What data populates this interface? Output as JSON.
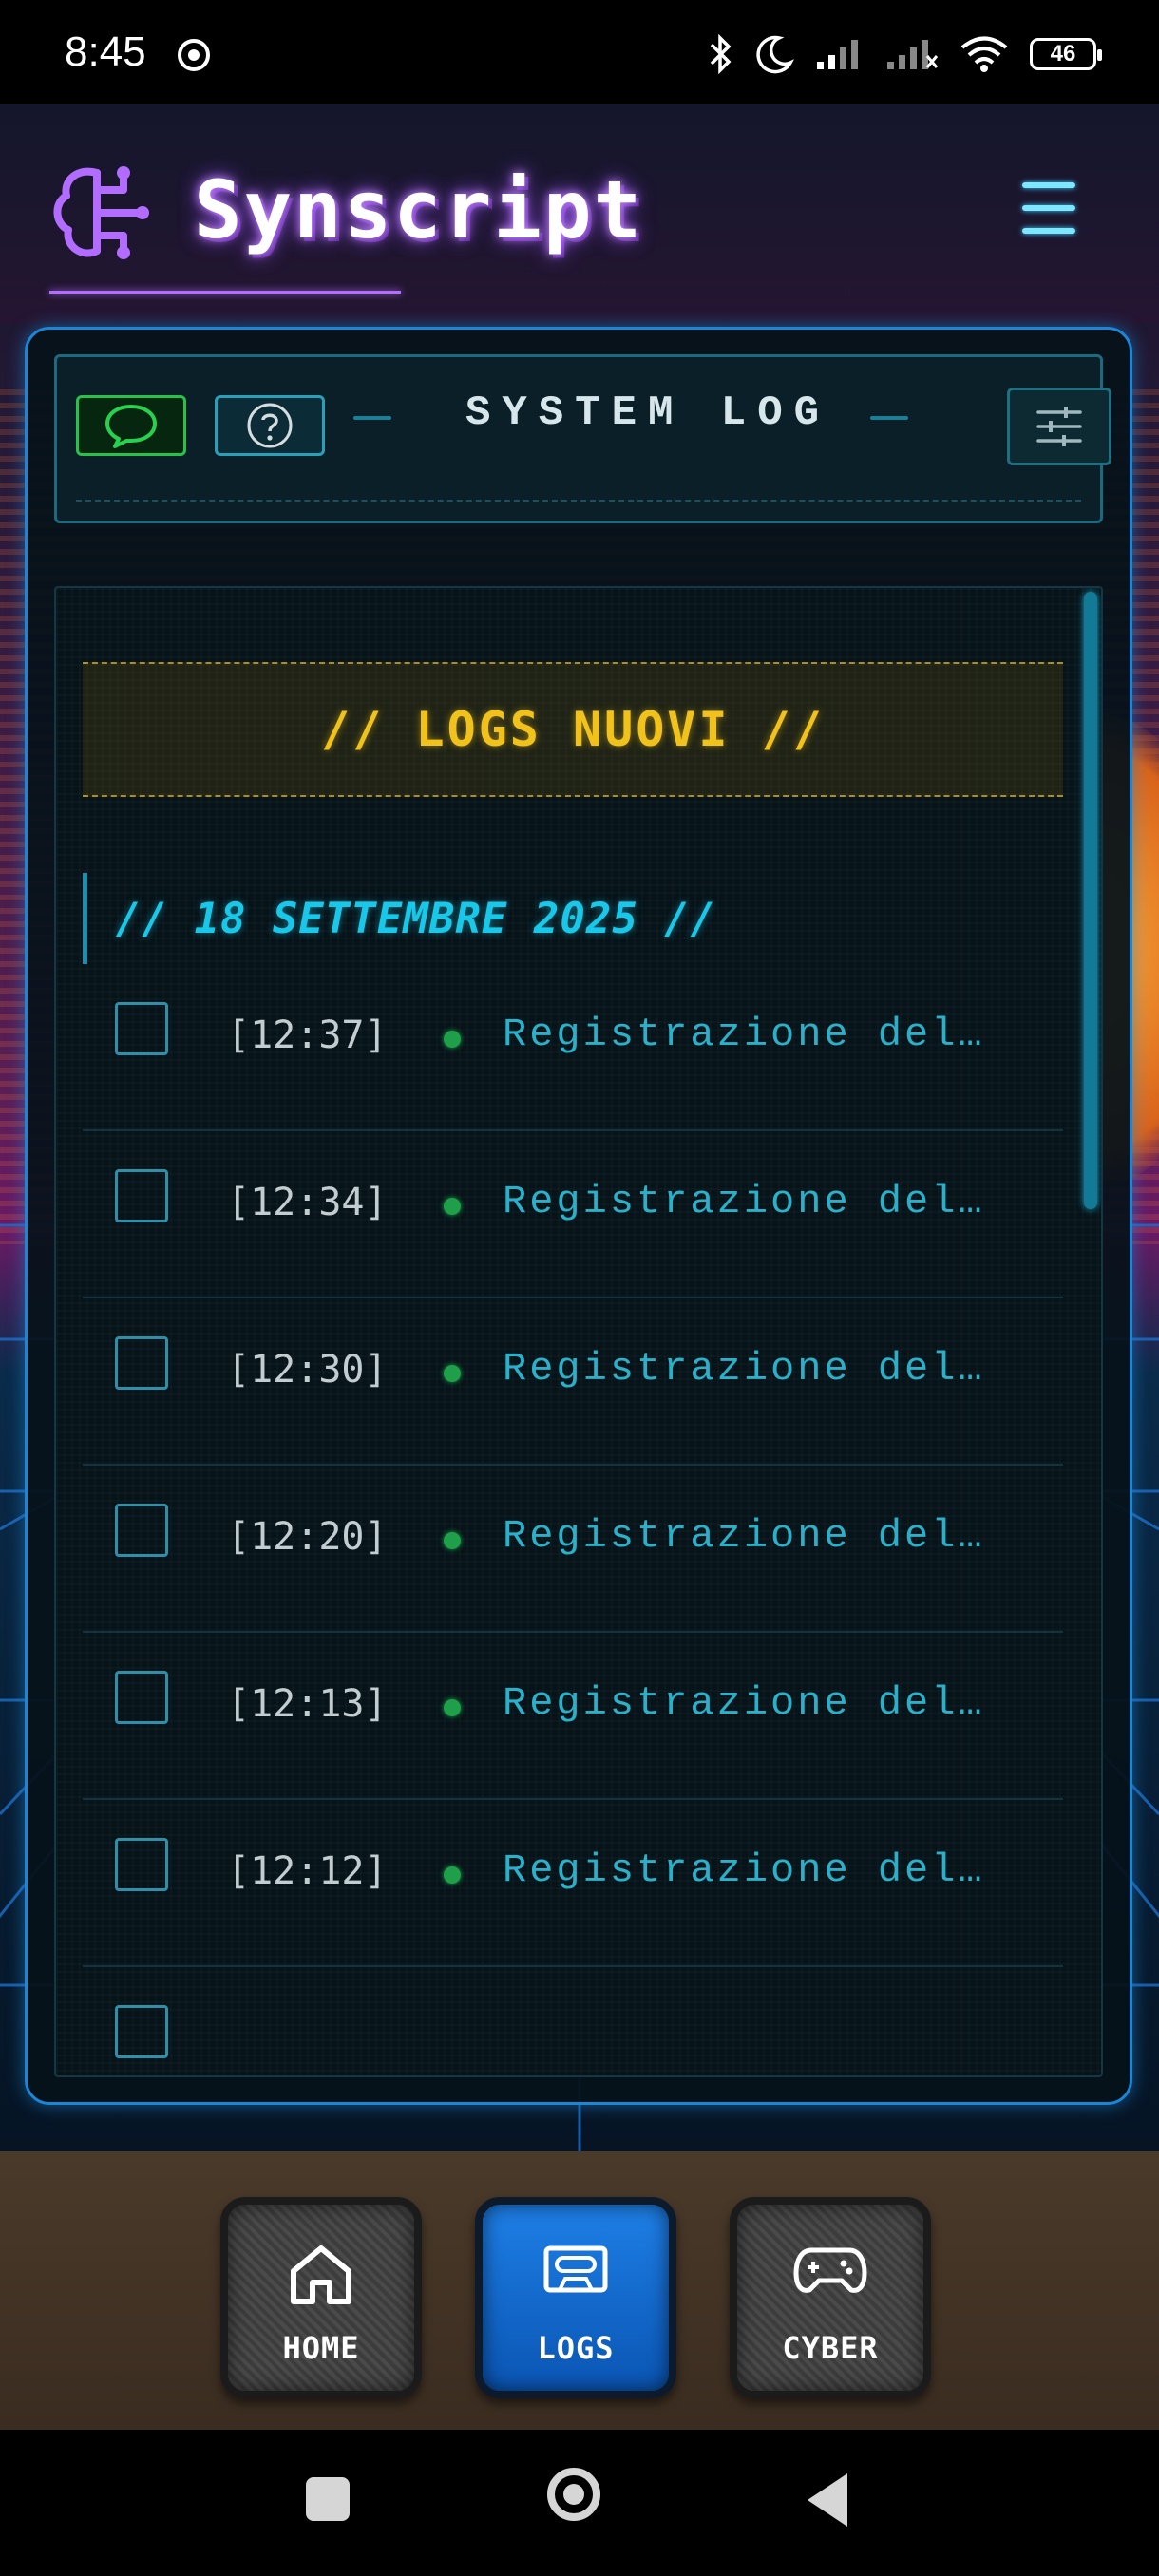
{
  "status_bar": {
    "time": "8:45",
    "battery": "46",
    "icons": [
      "chrome-icon",
      "bluetooth-icon",
      "moon-icon",
      "signal-icon",
      "signal-off-icon",
      "wifi-icon",
      "battery-icon"
    ]
  },
  "header": {
    "app_title": "Synscript",
    "brand_icon": "brain-icon",
    "menu_icon": "hamburger-menu-icon",
    "accent_color": "#b26cff"
  },
  "toolbar": {
    "title": "SYSTEM LOG",
    "chat_icon": "chat-bubble-icon",
    "help_icon": "question-mark-icon",
    "filter_icon": "sliders-icon"
  },
  "log": {
    "new_banner": "// LOGS NUOVI //",
    "date_header": "// 18 SETTEMBRE 2025 //",
    "entries": [
      {
        "time": "[12:37]",
        "text": "Registrazione del…"
      },
      {
        "time": "[12:34]",
        "text": "Registrazione del…"
      },
      {
        "time": "[12:30]",
        "text": "Registrazione del…"
      },
      {
        "time": "[12:20]",
        "text": "Registrazione del…"
      },
      {
        "time": "[12:13]",
        "text": "Registrazione del…"
      },
      {
        "time": "[12:12]",
        "text": "Registrazione del…"
      }
    ],
    "status_color": "#1f9f49",
    "text_color": "#2bb0c9",
    "banner_color": "#f2c21c"
  },
  "bottom_nav": {
    "items": [
      {
        "label": "HOME",
        "icon": "home-icon",
        "active": false
      },
      {
        "label": "LOGS",
        "icon": "cassette-icon",
        "active": true
      },
      {
        "label": "CYBER",
        "icon": "gamepad-icon",
        "active": false
      }
    ],
    "active_color": "#1e7fe6"
  }
}
